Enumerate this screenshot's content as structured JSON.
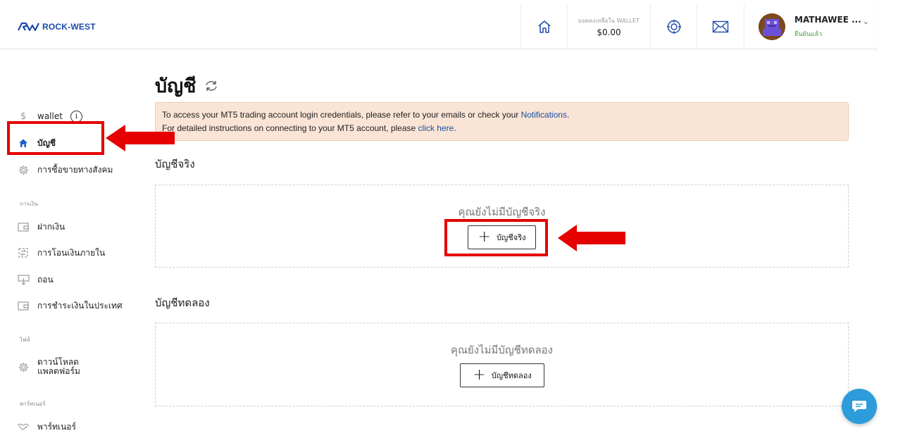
{
  "header": {
    "logo_text": "ROCK-WEST",
    "wallet_caption": "ยอดคงเหลือใน WALLET",
    "wallet_amount": "$0.00",
    "user_name": "MATHAWEE ...",
    "user_status": "ยืนยันแล้ว",
    "icons": [
      "home-icon",
      "target-icon",
      "mail-icon",
      "chevron-down-icon"
    ]
  },
  "sidebar": {
    "items": [
      {
        "label": "wallet",
        "icon": "dollar-icon"
      },
      {
        "label": "บัญชี",
        "icon": "home-icon"
      },
      {
        "label": "การซื้อขายทางสังคม",
        "icon": "gear-icon"
      }
    ],
    "groups": {
      "finance": "การเงิน",
      "file": "ไฟล์",
      "partner": "พาร์ทเนอร์"
    },
    "finance_items": [
      {
        "label": "ฝากเงิน",
        "icon": "wallet-icon"
      },
      {
        "label": "การโอนเงินภายใน",
        "icon": "transfer-icon"
      },
      {
        "label": "ถอน",
        "icon": "withdraw-icon"
      },
      {
        "label": "การชำระเงินในประเทศ",
        "icon": "wallet-icon"
      }
    ],
    "file_items": [
      {
        "label_line1": "ดาวน์โหลด",
        "label_line2": "แพลตฟอร์ม",
        "icon": "gear-icon"
      }
    ],
    "partner_items": [
      {
        "label": "พาร์ทเนอร์",
        "icon": "handshake-icon"
      }
    ]
  },
  "main": {
    "title": "บัญชี",
    "notice": {
      "line1_prefix": "To access your MT5 trading account login credentials, please refer to your emails or check your ",
      "line1_link": "Notifications",
      "line1_suffix": ".",
      "line2_prefix": "For detailed instructions on connecting to your MT5 account, please ",
      "line2_link": "click here",
      "line2_suffix": "."
    },
    "real": {
      "title": "บัญชีจริง",
      "empty_text": "คุณยังไม่มีบัญชีจริง",
      "button_label": "บัญชีจริง"
    },
    "demo": {
      "title": "บัญชีทดลอง",
      "empty_text": "คุณยังไม่มีบัญชีทดลอง",
      "button_label": "บัญชีทดลอง"
    }
  },
  "colors": {
    "accent_blue": "#1e4aa8",
    "annotation_red": "#e60000",
    "notice_bg": "#fae4d6",
    "chat_blue": "#2d9cdb",
    "verified_green": "#3aa23a"
  }
}
